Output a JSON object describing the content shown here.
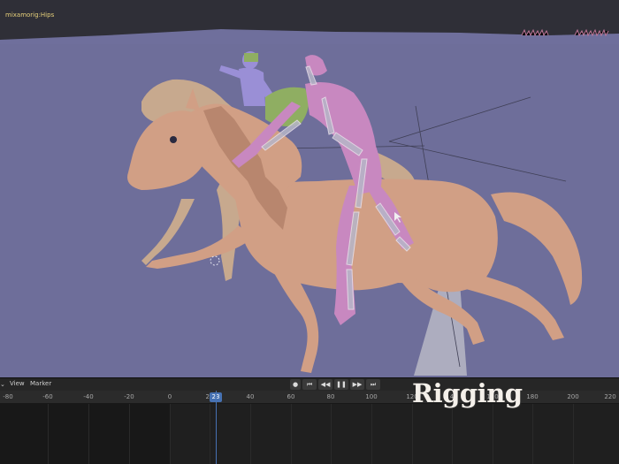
{
  "viewport": {
    "object_name": "mixamorig:Hips",
    "background_color": "#6e6e9a"
  },
  "timeline": {
    "menus": [
      "View",
      "Marker"
    ],
    "ruler_ticks": [
      "-80",
      "-60",
      "-40",
      "-20",
      "0",
      "20",
      "40",
      "60",
      "80",
      "100",
      "120",
      "140",
      "160",
      "180",
      "200",
      "220"
    ],
    "current_frame": "23",
    "playback_icons": [
      "record-icon",
      "jump-start-icon",
      "step-back-icon",
      "pause-icon",
      "step-forward-icon",
      "jump-end-icon"
    ]
  },
  "overlay": {
    "title": "Rigging"
  }
}
